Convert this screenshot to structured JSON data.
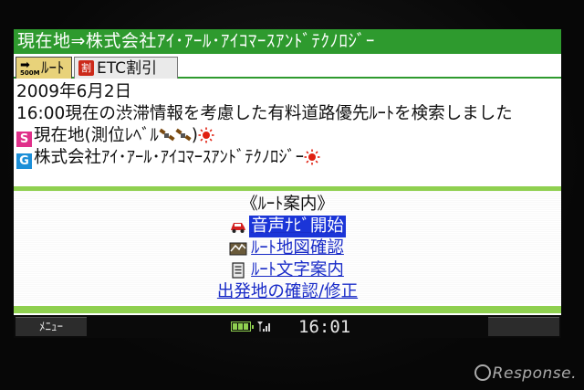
{
  "title_bar": {
    "text": "現在地⇒株式会社ｱｲ･ｱｰﾙ･ｱｲｺﾏｰｽｱﾝﾄﾞﾃｸﾉﾛｼﾞｰ"
  },
  "tabs": [
    {
      "label": "ﾙｰﾄ",
      "icon": "route-icon",
      "icon_small_text": "500M",
      "active": true
    },
    {
      "label": "ETC割引",
      "icon": "etc-icon",
      "icon_char": "割",
      "active": false
    }
  ],
  "info": {
    "date": "2009年6月2日",
    "description": "16:00現在の渋滞情報を考慮した有料道路優先ﾙｰﾄを検索しました",
    "start": {
      "badge": "S",
      "text": "現在地(測位ﾚﾍﾞﾙ",
      "suffix": ")"
    },
    "goal": {
      "badge": "G",
      "text": "株式会社ｱｲ･ｱｰﾙ･ｱｲｺﾏｰｽｱﾝﾄﾞﾃｸﾉﾛｼﾞｰ"
    }
  },
  "guide": {
    "title": "《ﾙｰﾄ案内》",
    "items": [
      {
        "label": "音声ﾅﾋﾞ開始",
        "icon": "car-icon",
        "selected": true
      },
      {
        "label": "ﾙｰﾄ地図確認",
        "icon": "map-icon",
        "selected": false
      },
      {
        "label": "ﾙｰﾄ文字案内",
        "icon": "document-icon",
        "selected": false
      },
      {
        "label": "出発地の確認/修正",
        "icon": "",
        "selected": false
      }
    ]
  },
  "softkeys": {
    "left": "ﾒﾆｭｰ",
    "right": ""
  },
  "status": {
    "time": "16:01"
  },
  "watermark": {
    "text": "Response."
  },
  "colors": {
    "title_bar": "#2e9a2e",
    "accent_green": "#8fd050",
    "link": "#1a2cc8",
    "selected": "#1b35d8",
    "start_badge": "#e0308a",
    "goal_badge": "#1c8fd8",
    "sun": "#e02010"
  }
}
